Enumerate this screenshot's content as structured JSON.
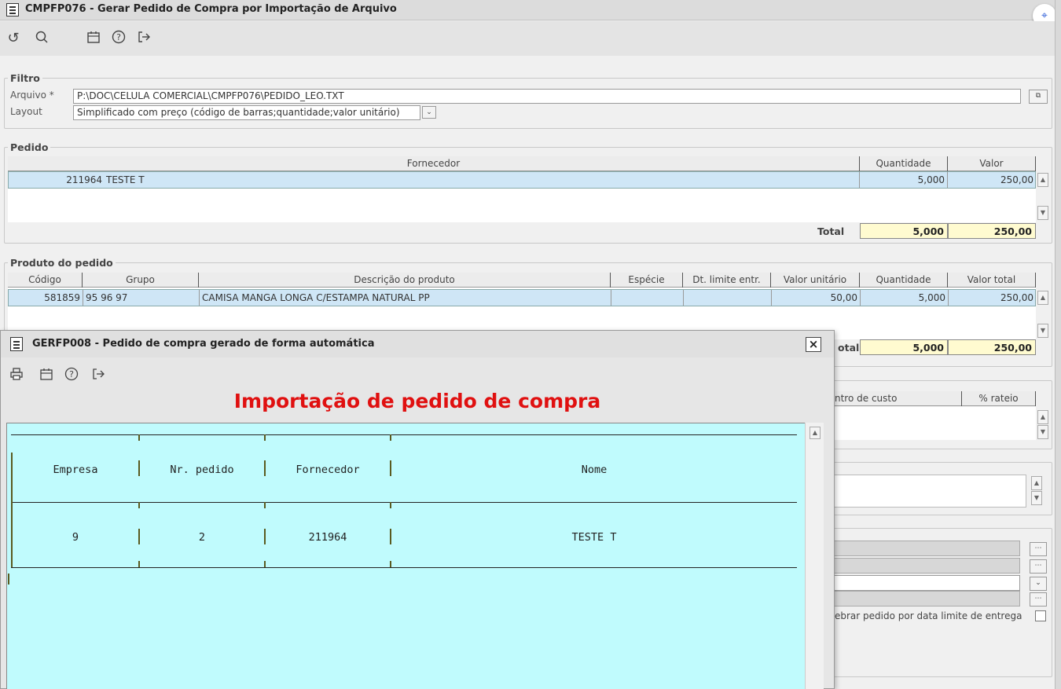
{
  "window": {
    "title": "CMPFP076 - Gerar Pedido de Compra por Importação de Arquivo",
    "toolbar_icons": [
      "undo-icon",
      "search-icon",
      "calendar-icon",
      "help-icon",
      "exit-icon"
    ]
  },
  "filtro": {
    "legend": "Filtro",
    "arquivo_label": "Arquivo *",
    "arquivo_value": "P:\\DOC\\CELULA COMERCIAL\\CMPFP076\\PEDIDO_LEO.TXT",
    "layout_label": "Layout",
    "layout_value": "Simplificado com preço (código de barras;quantidade;valor unitário)"
  },
  "pedido": {
    "legend": "Pedido",
    "columns": [
      "Fornecedor",
      "Quantidade",
      "Valor"
    ],
    "rows": [
      {
        "code": "211964",
        "fornecedor": "TESTE T",
        "quantidade": "5,000",
        "valor": "250,00"
      }
    ],
    "total_label": "Total",
    "total_quantidade": "5,000",
    "total_valor": "250,00"
  },
  "produto": {
    "legend": "Produto do pedido",
    "columns": [
      "Código",
      "Grupo",
      "Descrição do produto",
      "Espécie",
      "Dt. limite entr.",
      "Valor unitário",
      "Quantidade",
      "Valor total"
    ],
    "rows": [
      {
        "codigo": "581859",
        "grupo": "95 96 97",
        "descricao": "CAMISA MANGA LONGA C/ESTAMPA NATURAL PP",
        "especie": "",
        "dt_limite": "",
        "valor_unitario": "50,00",
        "quantidade": "5,000",
        "valor_total": "250,00"
      }
    ],
    "total_label_partial": "otal",
    "total_quantidade": "5,000",
    "total_valor": "250,00"
  },
  "rateio": {
    "col_centro_partial": "ntro de custo",
    "col_rateio": "% rateio"
  },
  "options": {
    "quebrar_label_partial": "ebrar pedido por data limite de entrega"
  },
  "dialog": {
    "title": "GERFP008 - Pedido de compra gerado de forma automática",
    "close_label": "×",
    "toolbar_icons": [
      "print-icon",
      "calendar-icon",
      "help-icon",
      "exit-icon"
    ],
    "report_title": "Importação de pedido de compra",
    "report_columns": [
      "Empresa",
      "Nr. pedido",
      "Fornecedor",
      "Nome"
    ],
    "report_rows": [
      {
        "empresa": "9",
        "nr_pedido": "2",
        "fornecedor": "211964",
        "nome": "TESTE T"
      }
    ]
  },
  "colors": {
    "selection": "#cfe6f6",
    "total_bg": "#fffbd0",
    "report_bg": "#c0fbfd",
    "report_title": "#e01010"
  }
}
